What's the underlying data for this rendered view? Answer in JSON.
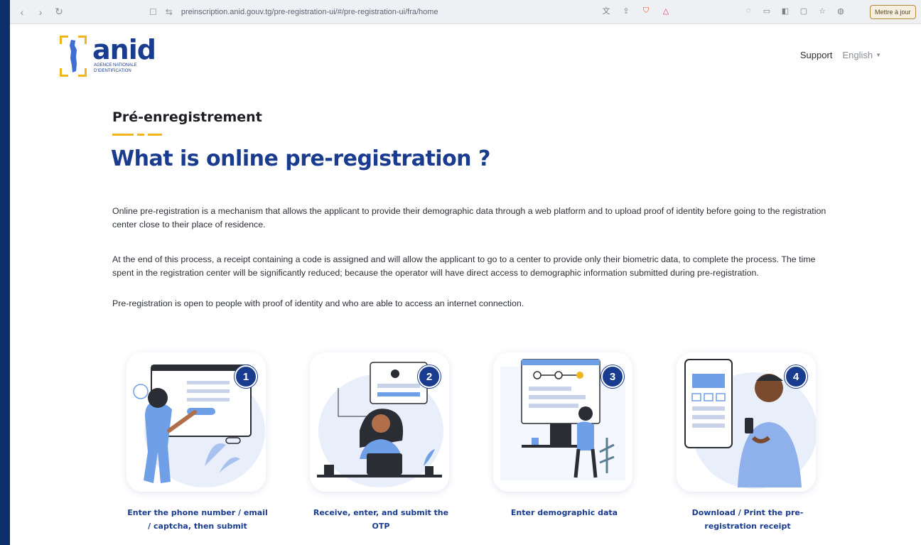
{
  "browser": {
    "url": "preinscription.anid.gouv.tg/pre-registration-ui/#/pre-registration-ui/fra/home",
    "update_label": "Mettre à jour"
  },
  "header": {
    "logo_text": "anid",
    "logo_subtext": "AGENCE NATIONALE D'IDENTIFICATION",
    "support_label": "Support",
    "language_label": "English"
  },
  "intro": {
    "eyebrow": "Pré-enregistrement",
    "headline": "What is online pre-registration ?",
    "paragraphs": [
      "Online pre-registration is a mechanism that allows the applicant to provide their demographic data through a web platform and to upload proof of identity before going to the registration center close to their place of residence.",
      "At the end of this process, a receipt containing a code is assigned and will allow the applicant to go to a center to provide only their biometric data, to complete the process. The time spent in the registration center will be significantly reduced; because the operator will have direct access to demographic information submitted during pre-registration.",
      "Pre-registration is open to people with proof of identity and who are able to access an internet connection."
    ]
  },
  "steps": [
    {
      "number": "1",
      "caption": "Enter the phone number / email / captcha, then submit"
    },
    {
      "number": "2",
      "caption": "Receive, enter, and submit the OTP"
    },
    {
      "number": "3",
      "caption": "Enter demographic data"
    },
    {
      "number": "4",
      "caption": "Download / Print the pre-registration receipt"
    }
  ],
  "colors": {
    "brand_blue": "#1a3c8f",
    "accent_yellow": "#f1b51c"
  }
}
